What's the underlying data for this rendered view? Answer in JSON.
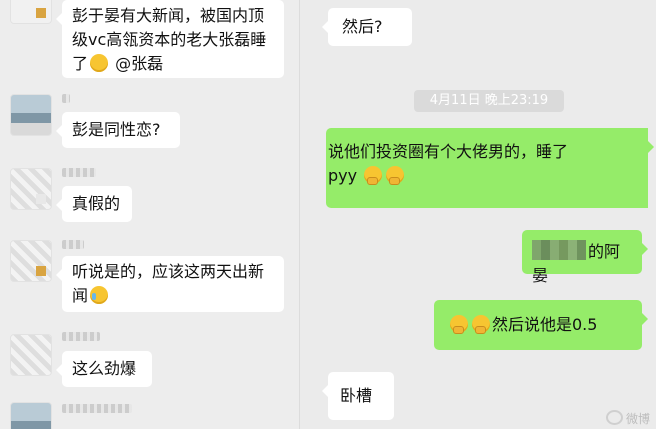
{
  "left_chat": {
    "messages": [
      {
        "parts": [
          "彭于晏有大新闻，被国内顶级vc高瓴资本的老大张磊睡了",
          "@张磊"
        ],
        "emoji": "grin-emoji"
      },
      {
        "text": "彭是同性恋?"
      },
      {
        "text": "真假的"
      },
      {
        "parts": [
          "听说是的，应该这两天出新闻"
        ],
        "emoji": "crying-laugh-emoji"
      },
      {
        "text": "这么劲爆"
      }
    ]
  },
  "right_chat": {
    "top_reply": "然后?",
    "timestamp": "4月11日 晚上23:19",
    "outgoing": [
      {
        "line1": "说他们投资圈有个大佬男的，睡了",
        "line2": "pyy"
      },
      {
        "text": "的阿晏"
      },
      {
        "text": "然后说他是0.5"
      }
    ],
    "bottom_reply": "卧槽"
  },
  "watermark": "微博"
}
